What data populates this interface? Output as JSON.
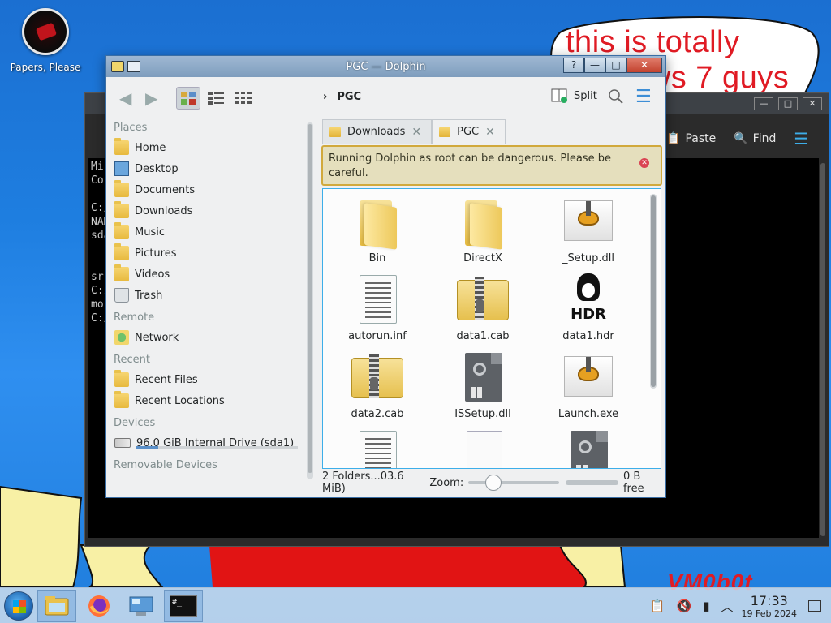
{
  "desktop": {
    "icon_label": "Papers, Please",
    "bubble_line1": "this is totally",
    "bubble_line2": "windows 7 guys",
    "watermark": "VM0b0t"
  },
  "console": {
    "toolbar": {
      "paste": "Paste",
      "find": "Find"
    },
    "lines": [
      "Mi",
      "Co",
      "",
      "C:/",
      "NAM",
      "sda",
      "",
      "",
      "sr",
      "C:/",
      "mo",
      "C:/"
    ]
  },
  "dolphin": {
    "title": "PGC — Dolphin",
    "breadcrumb": "PGC",
    "split_label": "Split",
    "places": {
      "sections": {
        "places": "Places",
        "remote": "Remote",
        "recent": "Recent",
        "devices": "Devices",
        "removable": "Removable Devices"
      },
      "items": [
        {
          "label": "Home",
          "icon": "home-folder-icon"
        },
        {
          "label": "Desktop",
          "icon": "desktop-icon"
        },
        {
          "label": "Documents",
          "icon": "documents-folder-icon"
        },
        {
          "label": "Downloads",
          "icon": "downloads-folder-icon"
        },
        {
          "label": "Music",
          "icon": "music-folder-icon"
        },
        {
          "label": "Pictures",
          "icon": "pictures-folder-icon"
        },
        {
          "label": "Videos",
          "icon": "videos-folder-icon"
        },
        {
          "label": "Trash",
          "icon": "trash-icon"
        }
      ],
      "remote_items": [
        {
          "label": "Network",
          "icon": "network-folder-icon"
        }
      ],
      "recent_items": [
        {
          "label": "Recent Files",
          "icon": "recent-files-icon"
        },
        {
          "label": "Recent Locations",
          "icon": "recent-locations-icon"
        }
      ],
      "device_items": [
        {
          "label": "96.0 GiB Internal Drive (sda1)",
          "icon": "drive-icon",
          "usage_fraction": 0.14
        }
      ]
    },
    "tabs": [
      {
        "label": "Downloads",
        "active": false
      },
      {
        "label": "PGC",
        "active": true
      }
    ],
    "warning": "Running Dolphin as root can be dangerous. Please be careful.",
    "files": [
      {
        "name": "Bin",
        "icon": "folder-icon"
      },
      {
        "name": "DirectX",
        "icon": "folder-icon"
      },
      {
        "name": "_Setup.dll",
        "icon": "installer-gear-icon"
      },
      {
        "name": "autorun.inf",
        "icon": "text-document-icon"
      },
      {
        "name": "data1.cab",
        "icon": "archive-icon"
      },
      {
        "name": "data1.hdr",
        "icon": "hdr-tux-icon"
      },
      {
        "name": "data2.cab",
        "icon": "archive-icon"
      },
      {
        "name": "ISSetup.dll",
        "icon": "library-icon"
      },
      {
        "name": "Launch.exe",
        "icon": "installer-gear-icon"
      },
      {
        "name": "",
        "icon": "text-document-icon"
      },
      {
        "name": "",
        "icon": "binary-document-icon"
      },
      {
        "name": "",
        "icon": "library-icon"
      }
    ],
    "status": {
      "summary": "2 Folders...03.6 MiB)",
      "zoom_label": "Zoom:",
      "zoom_level": 0.22,
      "free": "0 B free"
    }
  },
  "taskbar": {
    "time": "17:33",
    "date": "19 Feb 2024",
    "tasks": [
      "start-menu",
      "dolphin",
      "firefox",
      "system-settings",
      "konsole"
    ],
    "konsole_glyph": "#_"
  }
}
